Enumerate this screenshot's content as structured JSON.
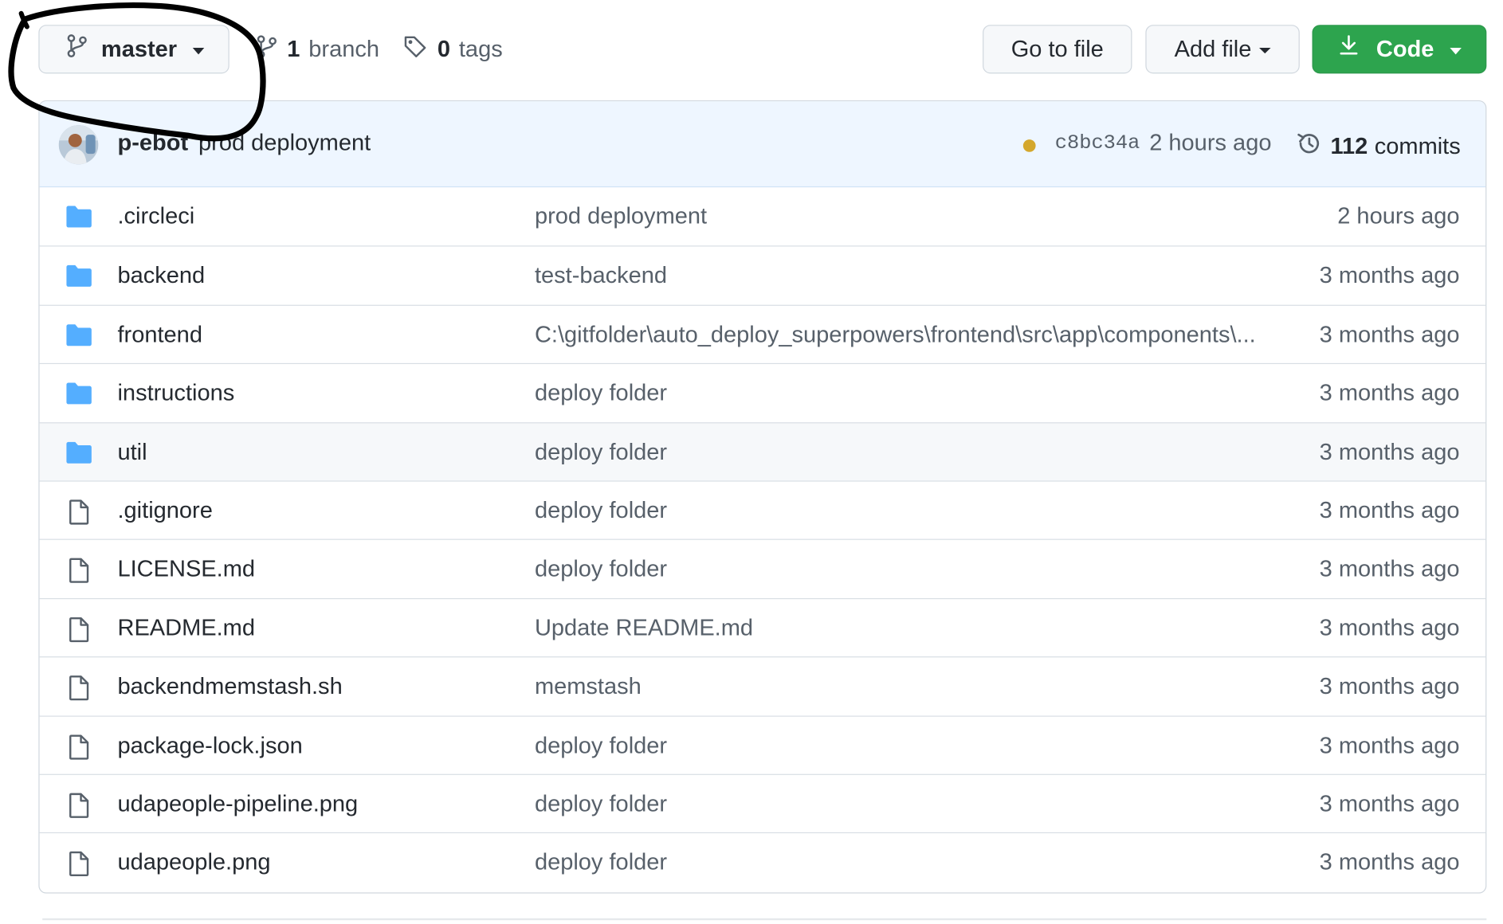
{
  "repo_bar": {
    "branch_selector": {
      "label": "master"
    },
    "branches": {
      "count": "1",
      "word": "branch"
    },
    "tags": {
      "count": "0",
      "word": "tags"
    },
    "go_to_file": "Go to file",
    "add_file": "Add file",
    "code": "Code",
    "code_color": "#2da44e"
  },
  "latest_commit": {
    "author": "p-ebot",
    "message": "prod deployment",
    "status": "pending",
    "status_color": "#d4a72c",
    "sha": "c8bc34a",
    "time": "2 hours ago",
    "commits_count": "112",
    "commits_word": "commits"
  },
  "files": [
    {
      "type": "folder",
      "name": ".circleci",
      "message": "prod deployment",
      "age": "2 hours ago"
    },
    {
      "type": "folder",
      "name": "backend",
      "message": "test-backend",
      "age": "3 months ago"
    },
    {
      "type": "folder",
      "name": "frontend",
      "message": "C:\\gitfolder\\auto_deploy_superpowers\\frontend\\src\\app\\components\\...",
      "age": "3 months ago"
    },
    {
      "type": "folder",
      "name": "instructions",
      "message": "deploy folder",
      "age": "3 months ago"
    },
    {
      "type": "folder",
      "name": "util",
      "message": "deploy folder",
      "age": "3 months ago"
    },
    {
      "type": "file",
      "name": ".gitignore",
      "message": "deploy folder",
      "age": "3 months ago"
    },
    {
      "type": "file",
      "name": "LICENSE.md",
      "message": "deploy folder",
      "age": "3 months ago"
    },
    {
      "type": "file",
      "name": "README.md",
      "message": "Update README.md",
      "age": "3 months ago"
    },
    {
      "type": "file",
      "name": "backendmemstash.sh",
      "message": "memstash",
      "age": "3 months ago"
    },
    {
      "type": "file",
      "name": "package-lock.json",
      "message": "deploy folder",
      "age": "3 months ago"
    },
    {
      "type": "file",
      "name": "udapeople-pipeline.png",
      "message": "deploy folder",
      "age": "3 months ago"
    },
    {
      "type": "file",
      "name": "udapeople.png",
      "message": "deploy folder",
      "age": "3 months ago"
    }
  ],
  "colors": {
    "folder_icon": "#54aeff",
    "file_icon": "#57606a",
    "header_bg": "#eef6ff",
    "annotation": "#000000"
  },
  "icons": {
    "branch": "git-branch-icon",
    "tag": "tag-icon",
    "download": "download-icon",
    "history": "history-icon",
    "folder": "folder-icon",
    "file": "file-icon"
  }
}
